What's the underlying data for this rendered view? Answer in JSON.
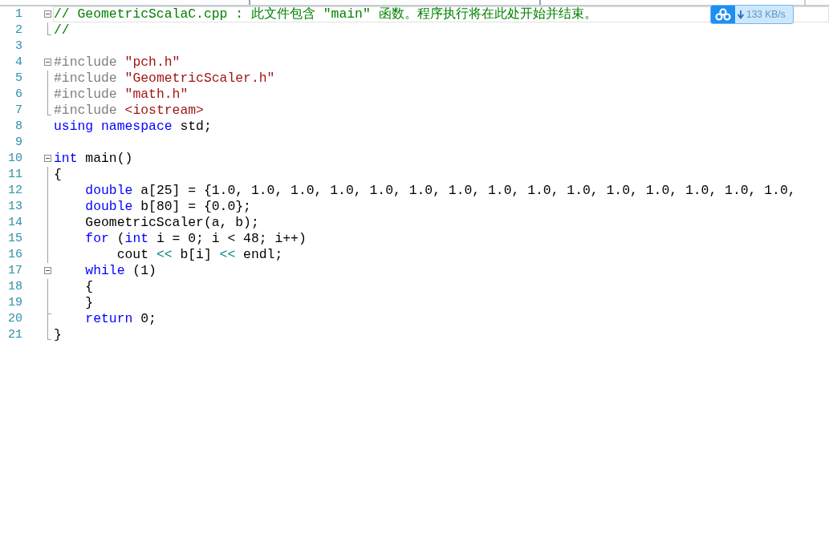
{
  "lines": [
    {
      "number": "1",
      "kind": "fold-start",
      "current": true,
      "tokens": [
        {
          "kind": "comment",
          "text": "// GeometricScalaC.cpp : 此文件包含 \"main\" 函数。程序执行将在此处开始并结束。"
        }
      ]
    },
    {
      "number": "2",
      "kind": "fold-end",
      "tokens": [
        {
          "kind": "comment",
          "text": "//"
        }
      ]
    },
    {
      "number": "3",
      "kind": "plain"
    },
    {
      "number": "4",
      "kind": "fold-start",
      "tokens": [
        {
          "kind": "preproc",
          "text": "#include"
        },
        {
          "kind": "string",
          "text": " \"pch.h\""
        }
      ]
    },
    {
      "number": "5",
      "kind": "fold-body",
      "tokens": [
        {
          "kind": "preproc",
          "text": "#include"
        },
        {
          "kind": "string",
          "text": " \"GeometricScaler.h\""
        }
      ]
    },
    {
      "number": "6",
      "kind": "fold-body",
      "tokens": [
        {
          "kind": "preproc",
          "text": "#include"
        },
        {
          "kind": "string",
          "text": " \"math.h\""
        }
      ]
    },
    {
      "number": "7",
      "kind": "fold-end",
      "tokens": [
        {
          "kind": "preproc",
          "text": "#include"
        },
        {
          "kind": "string",
          "text": " <iostream>"
        }
      ]
    },
    {
      "number": "8",
      "kind": "plain",
      "tokens": [
        {
          "kind": "keyword",
          "text": "using"
        },
        {
          "kind": "keyword",
          "text": " namespace"
        },
        {
          "kind": "plain",
          "text": " std;"
        }
      ]
    },
    {
      "number": "9",
      "kind": "plain"
    },
    {
      "number": "10",
      "kind": "fold-start",
      "tokens": [
        {
          "kind": "keyword",
          "text": "int"
        },
        {
          "kind": "plain",
          "text": " main()"
        }
      ]
    },
    {
      "number": "11",
      "kind": "fold-body",
      "tokens": [
        {
          "kind": "plain",
          "text": "{"
        }
      ]
    },
    {
      "number": "12",
      "kind": "fold-body",
      "tokens": [
        {
          "kind": "keyword",
          "text": "    double"
        },
        {
          "kind": "plain",
          "text": " a[25] = {1.0, 1.0, 1.0, 1.0, 1.0, 1.0, 1.0, 1.0, 1.0, 1.0, 1.0, 1.0, 1.0, 1.0, 1.0,"
        }
      ]
    },
    {
      "number": "13",
      "kind": "fold-body",
      "tokens": [
        {
          "kind": "keyword",
          "text": "    double"
        },
        {
          "kind": "plain",
          "text": " b[80] = {0.0};"
        }
      ]
    },
    {
      "number": "14",
      "kind": "fold-body",
      "tokens": [
        {
          "kind": "plain",
          "text": "    GeometricScaler(a, b);"
        }
      ]
    },
    {
      "number": "15",
      "kind": "fold-body",
      "tokens": [
        {
          "kind": "keyword",
          "text": "    for"
        },
        {
          "kind": "plain",
          "text": " ("
        },
        {
          "kind": "keyword",
          "text": "int"
        },
        {
          "kind": "plain",
          "text": " i = 0; i < 48; i++)"
        }
      ]
    },
    {
      "number": "16",
      "kind": "fold-body",
      "tokens": [
        {
          "kind": "plain",
          "text": "        cout"
        },
        {
          "kind": "operator",
          "text": " <<"
        },
        {
          "kind": "plain",
          "text": " b[i]"
        },
        {
          "kind": "operator",
          "text": " <<"
        },
        {
          "kind": "plain",
          "text": " endl;"
        }
      ]
    },
    {
      "number": "17",
      "kind": "fold-start",
      "tokens": [
        {
          "kind": "keyword",
          "text": "    while"
        },
        {
          "kind": "plain",
          "text": " (1)"
        }
      ]
    },
    {
      "number": "18",
      "kind": "fold-body",
      "tokens": [
        {
          "kind": "plain",
          "text": "    {"
        }
      ]
    },
    {
      "number": "19",
      "kind": "fold-body",
      "tokens": [
        {
          "kind": "plain",
          "text": "    }"
        }
      ]
    },
    {
      "number": "20",
      "kind": "fold-inner-end",
      "tokens": [
        {
          "kind": "keyword",
          "text": "    return"
        },
        {
          "kind": "plain",
          "text": " 0;"
        }
      ]
    },
    {
      "number": "21",
      "kind": "fold-end",
      "tokens": [
        {
          "kind": "plain",
          "text": "}"
        }
      ]
    }
  ],
  "speed_widget": {
    "text": "133 KB/s"
  }
}
